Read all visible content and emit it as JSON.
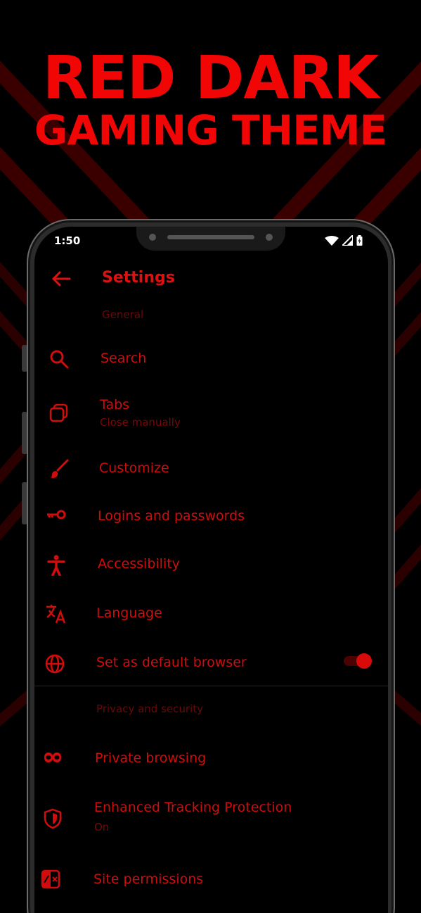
{
  "promo": {
    "line1": "RED DARK",
    "line2": "GAMING THEME"
  },
  "status_bar": {
    "time": "1:50",
    "icons": [
      "wifi-icon",
      "signal-icon",
      "battery-icon"
    ]
  },
  "app_bar": {
    "title": "Settings",
    "back_icon": "arrow-left-icon"
  },
  "sections": {
    "general": "General",
    "privacy": "Privacy and security"
  },
  "items": [
    {
      "label": "Search",
      "icon": "search-icon"
    },
    {
      "label": "Tabs",
      "sub": "Close manually",
      "icon": "tabs-icon"
    },
    {
      "label": "Customize",
      "icon": "brush-icon"
    },
    {
      "label": "Logins and passwords",
      "icon": "key-icon"
    },
    {
      "label": "Accessibility",
      "icon": "accessibility-icon"
    },
    {
      "label": "Language",
      "icon": "translate-icon"
    },
    {
      "label": "Set as default browser",
      "icon": "globe-icon",
      "toggle_on": true
    },
    {
      "label": "Private browsing",
      "icon": "mask-icon"
    },
    {
      "label": "Enhanced Tracking Protection",
      "sub": "On",
      "icon": "shield-icon"
    },
    {
      "label": "Site permissions",
      "icon": "site-permissions-icon"
    }
  ],
  "colors": {
    "accent": "#e01010",
    "muted": "#6a0808",
    "background": "#000000"
  }
}
